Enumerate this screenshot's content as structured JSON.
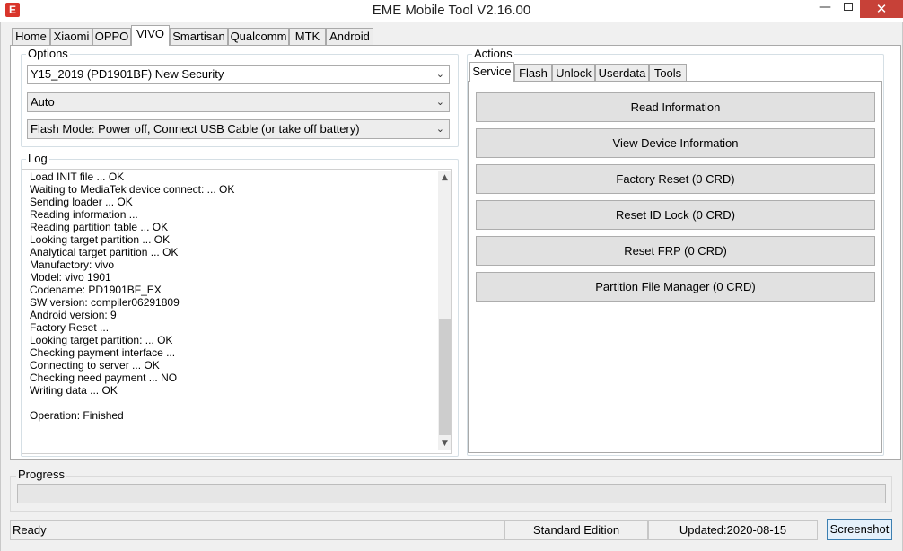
{
  "window": {
    "title": "EME Mobile Tool V2.16.00",
    "icon_letter": "E",
    "minimize": "—",
    "close": "✕"
  },
  "main_tabs": [
    "Home",
    "Xiaomi",
    "OPPO",
    "VIVO",
    "Smartisan",
    "Qualcomm",
    "MTK",
    "Android"
  ],
  "active_main_tab": "VIVO",
  "options": {
    "label": "Options",
    "model_value": "Y15_2019 (PD1901BF) New Security",
    "mode_value": "Auto",
    "flash_mode_value": "Flash Mode: Power off, Connect USB Cable (or take off battery)"
  },
  "log": {
    "label": "Log",
    "lines": [
      "Load INIT file ... OK",
      "Waiting to MediaTek device connect: ... OK",
      "Sending loader ... OK",
      "Reading information ...",
      "Reading partition table ... OK",
      "Looking target partition ... OK",
      "Analytical target partition ... OK",
      "Manufactory: vivo",
      "Model: vivo 1901",
      "Codename: PD1901BF_EX",
      "SW version: compiler06291809",
      "Android version: 9",
      "Factory Reset ...",
      "Looking target partition: ... OK",
      "Checking payment interface ...",
      "Connecting to server ... OK",
      "Checking need payment ... NO",
      "Writing data ... OK",
      "",
      "Operation: Finished"
    ]
  },
  "actions": {
    "label": "Actions",
    "tabs": [
      "Service",
      "Flash",
      "Unlock",
      "Userdata",
      "Tools"
    ],
    "active_tab": "Service",
    "buttons": [
      "Read Information",
      "View Device Information",
      "Factory Reset (0 CRD)",
      "Reset ID Lock (0 CRD)",
      "Reset FRP (0 CRD)",
      "Partition File Manager (0 CRD)"
    ]
  },
  "progress": {
    "label": "Progress",
    "value": 0
  },
  "status": {
    "state": "Ready",
    "edition": "Standard Edition",
    "updated": "Updated:2020-08-15",
    "screenshot_button": "Screenshot"
  },
  "colors": {
    "close_button": "#c74138",
    "app_icon": "#d9352b",
    "progress_fill": "#06b025"
  },
  "icons": {
    "app": "eme-logo-icon",
    "dropdown": "chevron-down-icon",
    "scroll_up": "scroll-up-arrow-icon",
    "scroll_down": "scroll-down-arrow-icon"
  }
}
